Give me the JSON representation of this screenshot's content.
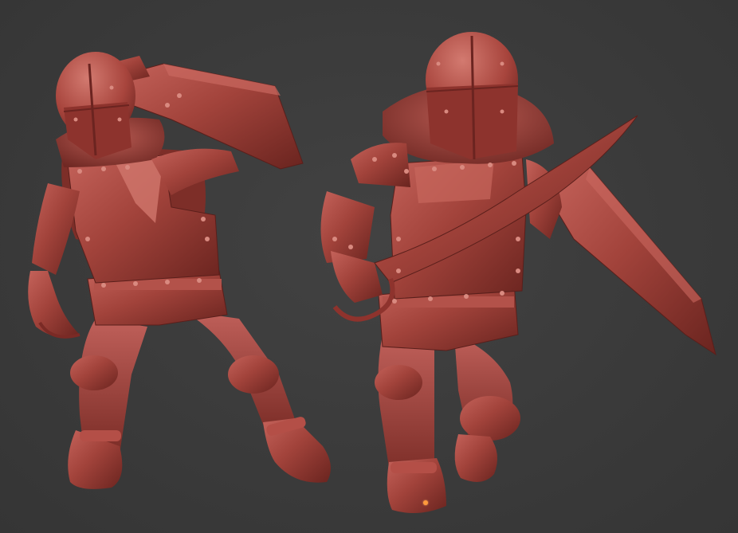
{
  "scene": {
    "subject": "two-armored-knight-sculpts",
    "background_color": "#3c3c3c",
    "material_color": "#9a3a33",
    "material_highlight": "#c7665c",
    "material_shadow": "#5e1f1b",
    "pivot_color": "#ff9a3c"
  }
}
